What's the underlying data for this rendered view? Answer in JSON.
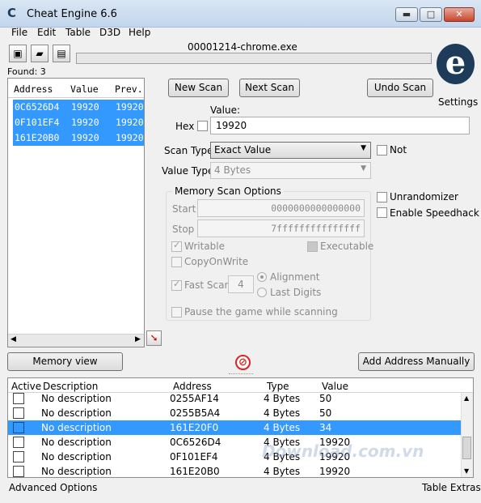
{
  "window": {
    "title": "Cheat Engine 6.6",
    "min_glyph": "▬",
    "max_glyph": "□",
    "close_glyph": "✕"
  },
  "menu": [
    "File",
    "Edit",
    "Table",
    "D3D",
    "Help"
  ],
  "process": "00001214-chrome.exe",
  "settings": "Settings",
  "found": "Found: 3",
  "address_list": {
    "headers": [
      "Address",
      "Value",
      "Prev."
    ],
    "rows": [
      {
        "address": "0C6526D4",
        "value": "19920",
        "prev": "19920"
      },
      {
        "address": "0F101EF4",
        "value": "19920",
        "prev": "19920"
      },
      {
        "address": "161E20B0",
        "value": "19920",
        "prev": "19920"
      }
    ]
  },
  "buttons": {
    "new_scan": "New Scan",
    "next_scan": "Next Scan",
    "undo_scan": "Undo Scan",
    "memory_view": "Memory view",
    "add_address": "Add Address Manually"
  },
  "value_label": "Value:",
  "hex_label": "Hex",
  "value_input": "19920",
  "scan_type": {
    "label": "Scan Type",
    "selected": "Exact Value"
  },
  "not_label": "Not",
  "value_type": {
    "label": "Value Type",
    "selected": "4 Bytes"
  },
  "mso": {
    "title": "Memory Scan Options",
    "start_label": "Start",
    "start_value": "0000000000000000",
    "stop_label": "Stop",
    "stop_value": "7fffffffffffffff",
    "writable": "Writable",
    "executable": "Executable",
    "copyonwrite": "CopyOnWrite",
    "fastscan": "Fast Scan",
    "fastscan_value": "4",
    "alignment": "Alignment",
    "lastdigits": "Last Digits",
    "pause": "Pause the game while scanning"
  },
  "unrandomizer": "Unrandomizer",
  "speedhack": "Enable Speedhack",
  "cheat_table": {
    "headers": [
      "Active",
      "Description",
      "Address",
      "Type",
      "Value"
    ],
    "rows": [
      {
        "desc": "No description",
        "address": "0255AF14",
        "type": "4 Bytes",
        "value": "50",
        "selected": false
      },
      {
        "desc": "No description",
        "address": "0255B5A4",
        "type": "4 Bytes",
        "value": "50",
        "selected": false
      },
      {
        "desc": "No description",
        "address": "161E20F0",
        "type": "4 Bytes",
        "value": "34",
        "selected": true
      },
      {
        "desc": "No description",
        "address": "0C6526D4",
        "type": "4 Bytes",
        "value": "19920",
        "selected": false
      },
      {
        "desc": "No description",
        "address": "0F101EF4",
        "type": "4 Bytes",
        "value": "19920",
        "selected": false
      },
      {
        "desc": "No description",
        "address": "161E20B0",
        "type": "4 Bytes",
        "value": "19920",
        "selected": false
      }
    ]
  },
  "advanced_options": "Advanced Options",
  "table_extras": "Table Extras",
  "watermark": "Download.com.vn"
}
